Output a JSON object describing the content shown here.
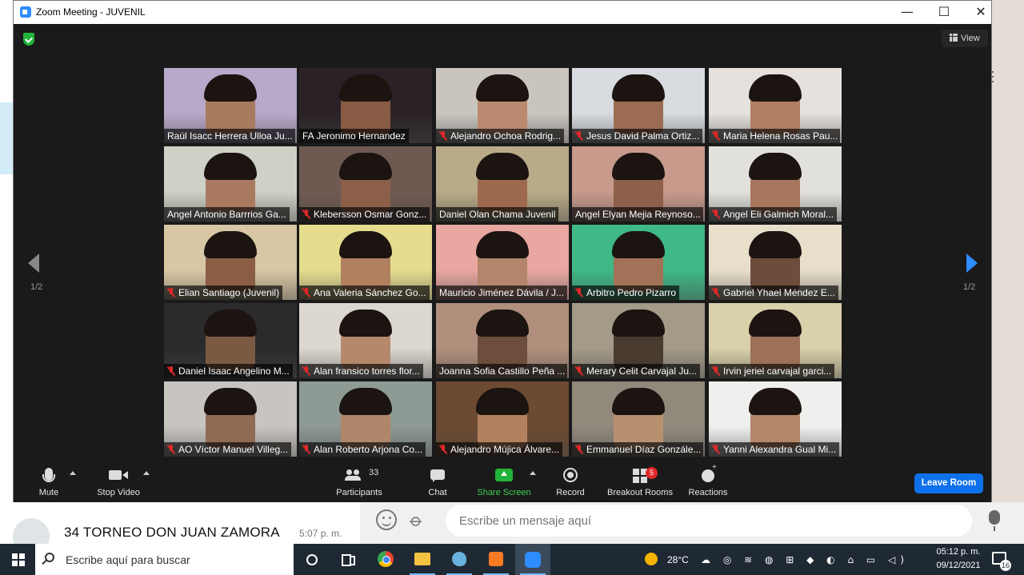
{
  "window": {
    "title": "Zoom Meeting - JUVENIL",
    "minimize": "—",
    "maximize": "☐",
    "close": "✕"
  },
  "view_label": "View",
  "pagination": {
    "left": "1/2",
    "right": "1/2"
  },
  "tiles": [
    {
      "name": "Raúl Isacc Herrera Ulloa Ju...",
      "muted": false,
      "bg": "#b7a9c9",
      "skin": "#a87a5e",
      "active": false
    },
    {
      "name": "FA Jeronimo Hernandez",
      "muted": false,
      "bg": "#2a2226",
      "skin": "#8a5b44",
      "active": true
    },
    {
      "name": "Alejandro Ochoa Rodrig...",
      "muted": true,
      "bg": "#c9c4be",
      "skin": "#b98a70",
      "active": false
    },
    {
      "name": "Jesus David Palma Ortiz...",
      "muted": true,
      "bg": "#d8dbdf",
      "skin": "#9c6c52",
      "active": false
    },
    {
      "name": "Maria Helena Rosas Pau...",
      "muted": true,
      "bg": "#e6e1dc",
      "skin": "#b07f63",
      "active": false
    },
    {
      "name": "Angel Antonio Barrrios Ga...",
      "muted": false,
      "bg": "#cfd1c6",
      "skin": "#a97a5f",
      "active": false
    },
    {
      "name": "Klebersson Osmar Gonz...",
      "muted": true,
      "bg": "#6f5a52",
      "skin": "#8c5f48",
      "active": false
    },
    {
      "name": "Daniel Olan Chama Juvenil",
      "muted": false,
      "bg": "#b9ab88",
      "skin": "#9d6a4f",
      "active": false
    },
    {
      "name": "Angel Elyan Mejia Reynoso...",
      "muted": false,
      "bg": "#c89a8c",
      "skin": "#8d604b",
      "active": false
    },
    {
      "name": "Angel Eli Galmich Moral...",
      "muted": true,
      "bg": "#e2e0dc",
      "skin": "#a6775d",
      "active": false
    },
    {
      "name": "Elian Santiago (Juvenil)",
      "muted": true,
      "bg": "#d8c7a4",
      "skin": "#8b5d45",
      "active": false
    },
    {
      "name": "Ana Valeria Sánchez Go...",
      "muted": true,
      "bg": "#e5dc8e",
      "skin": "#b1805f",
      "active": false
    },
    {
      "name": "Mauricio Jiménez Dávila / J...",
      "muted": false,
      "bg": "#e9a7a1",
      "skin": "#b3856a",
      "active": false
    },
    {
      "name": "Arbitro Pedro Pizarro",
      "muted": true,
      "bg": "#3fb986",
      "skin": "#a27258",
      "active": false
    },
    {
      "name": "Gabriel Yhael Méndez E...",
      "muted": true,
      "bg": "#e8dfcb",
      "skin": "#6e4c3c",
      "active": false
    },
    {
      "name": "Daniel Isaac Angelino M...",
      "muted": true,
      "bg": "#2b2b2b",
      "skin": "#7b5a44",
      "active": false
    },
    {
      "name": "Alan fransico torres flor...",
      "muted": true,
      "bg": "#dcd8cf",
      "skin": "#b5886c",
      "active": false
    },
    {
      "name": "Joanna Sofia Castillo Peña ...",
      "muted": false,
      "bg": "#b28f7d",
      "skin": "#6d4d3d",
      "active": false
    },
    {
      "name": "Merary Celit Carvajal Ju...",
      "muted": true,
      "bg": "#a39a88",
      "skin": "#4a3b30",
      "active": false
    },
    {
      "name": "Irvin jeriel carvajal garci...",
      "muted": true,
      "bg": "#d9d1a9",
      "skin": "#9d7057",
      "active": false
    },
    {
      "name": "AO Víctor Manuel Villeg...",
      "muted": true,
      "bg": "#c8c4c0",
      "skin": "#8f6b55",
      "active": false
    },
    {
      "name": "Alan Roberto Arjona Co...",
      "muted": true,
      "bg": "#8e9a94",
      "skin": "#b0866b",
      "active": false
    },
    {
      "name": "Alejandro Mújica Álvare...",
      "muted": true,
      "bg": "#6d4a32",
      "skin": "#b1815f",
      "active": false
    },
    {
      "name": "Emmanuel Díaz Gonzále...",
      "muted": true,
      "bg": "#91897c",
      "skin": "#b9906f",
      "active": false
    },
    {
      "name": "Yanni Alexandra Gual Mi...",
      "muted": true,
      "bg": "#efefed",
      "skin": "#b4876a",
      "active": false
    }
  ],
  "toolbar": {
    "mute": "Mute",
    "stop_video": "Stop Video",
    "participants": "Participants",
    "participant_count": "33",
    "chat": "Chat",
    "share_screen": "Share Screen",
    "record": "Record",
    "breakout_rooms": "Breakout Rooms",
    "breakout_badge": "5",
    "reactions": "Reactions",
    "leave_room": "Leave Room"
  },
  "background_app": {
    "chat_title": "34 TORNEO DON JUAN ZAMORA",
    "chat_time": "5:07 p. m.",
    "message_placeholder": "Escribe un mensaje aquí"
  },
  "taskbar": {
    "search_placeholder": "Escribe aquí para buscar",
    "temperature": "28°C",
    "tray": "☁ ◎ ≋ ◍ ⊞ ◆ ◐ ⌂ ▭ ◁)",
    "time": "05:12 p. m.",
    "date": "09/12/2021",
    "notification_count": "16"
  }
}
